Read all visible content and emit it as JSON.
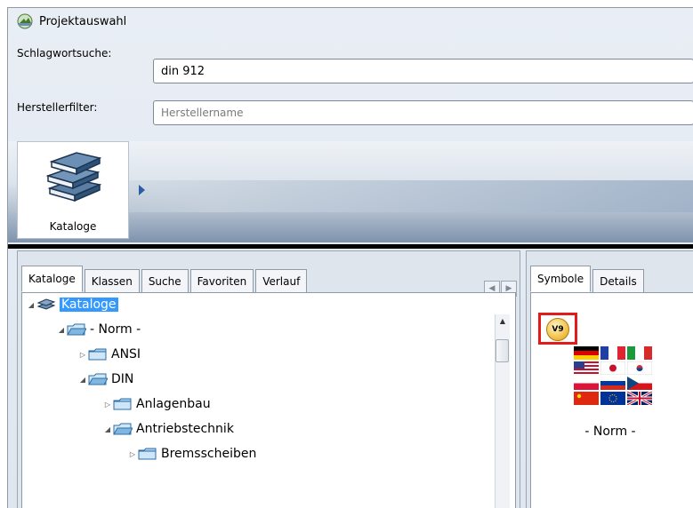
{
  "window": {
    "title": "Projektauswahl"
  },
  "search": {
    "keyword_label": "Schlagwortsuche:",
    "keyword_value": "din 912",
    "manufacturer_label": "Herstellerfilter:",
    "manufacturer_placeholder": "Herstellername"
  },
  "toolbar": {
    "catalog_tile_label": "Kataloge"
  },
  "left_tabs": [
    {
      "label": "Kataloge"
    },
    {
      "label": "Klassen"
    },
    {
      "label": "Suche"
    },
    {
      "label": "Favoriten"
    },
    {
      "label": "Verlauf"
    }
  ],
  "tree": [
    {
      "label": "Kataloge"
    },
    {
      "label": "- Norm -"
    },
    {
      "label": "ANSI"
    },
    {
      "label": "DIN"
    },
    {
      "label": "Anlagenbau"
    },
    {
      "label": "Antriebstechnik"
    },
    {
      "label": "Bremsscheiben"
    }
  ],
  "right_tabs": [
    {
      "label": "Symbole"
    },
    {
      "label": "Details"
    }
  ],
  "symbol": {
    "badge": "V9",
    "caption": "- Norm -"
  },
  "colors": {
    "accent": "#2a5ea0",
    "selection": "#3399ff",
    "highlight_border": "#e21b1b"
  }
}
